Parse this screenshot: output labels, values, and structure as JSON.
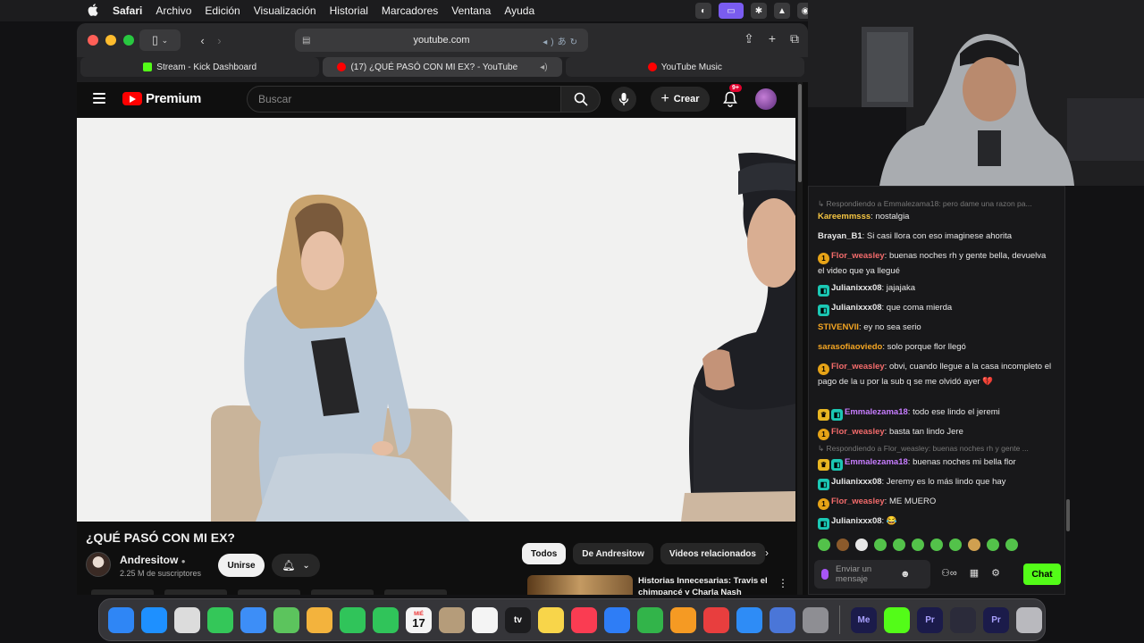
{
  "menubar": {
    "items": [
      "Safari",
      "Archivo",
      "Edición",
      "Visualización",
      "Historial",
      "Marcadores",
      "Ventana",
      "Ayuda"
    ]
  },
  "safari": {
    "address": "youtube.com",
    "tabs": [
      {
        "label": "Stream - Kick Dashboard",
        "favicon_color": "#53fc18"
      },
      {
        "label": "(17) ¿QUÉ PASÓ CON MI EX? - YouTube",
        "favicon_color": "#ff0000"
      },
      {
        "label": "YouTube Music",
        "favicon_color": "#ff0000"
      }
    ]
  },
  "youtube": {
    "logo_text": "Premium",
    "search_placeholder": "Buscar",
    "create_label": "Crear",
    "notif_badge": "9+",
    "video_title": "¿QUÉ PASÓ CON MI EX?",
    "channel_name": "Andresitow",
    "channel_subs": "2.25 M de suscriptores",
    "join_label": "Unirse",
    "chips": [
      "Todos",
      "De Andresitow",
      "Videos relacionados"
    ],
    "related_title": "Historias Innecesarias: Travis el chimpancé y Charla Nash"
  },
  "chat": {
    "messages": [
      {
        "type": "reply",
        "text": "Respondiendo a Emmalezama18: pero dame una razon pa..."
      },
      {
        "user": "Kareemmsss",
        "color": "#f5c542",
        "badges": [],
        "text": "nostalgia"
      },
      {
        "user": "Brayan_B1",
        "color": "#e8e8e8",
        "badges": [],
        "text": "Si casi llora con eso imaginese ahorita"
      },
      {
        "user": "Flor_weasley",
        "color": "#f36b6b",
        "badges": [
          "gold"
        ],
        "text": "buenas noches rh y gente bella, devuelva el video que ya llegué"
      },
      {
        "user": "Julianixxx08",
        "color": "#e8e8e8",
        "badges": [
          "teal"
        ],
        "text": "jajajaka"
      },
      {
        "user": "Julianixxx08",
        "color": "#e8e8e8",
        "badges": [
          "teal"
        ],
        "text": "que coma mierda"
      },
      {
        "user": "STIVENVII",
        "color": "#f5a623",
        "badges": [],
        "text": "ey no sea serio"
      },
      {
        "user": "sarasofiaoviedo",
        "color": "#f5a623",
        "badges": [],
        "text": "solo porque flor llegó"
      },
      {
        "user": "Flor_weasley",
        "color": "#f36b6b",
        "badges": [
          "gold"
        ],
        "text": "obvi, cuando llegue a la casa incompleto el pago de la u por la sub q se me olvidó ayer 💔"
      },
      {
        "user": "Emmalezama18",
        "color": "#c77dff",
        "badges": [
          "crown",
          "teal"
        ],
        "text": "todo ese lindo el jeremi"
      },
      {
        "user": "Flor_weasley",
        "color": "#f36b6b",
        "badges": [
          "gold"
        ],
        "text": "basta tan lindo Jere"
      },
      {
        "type": "reply",
        "text": "Respondiendo a Flor_weasley: buenas noches rh y gente ..."
      },
      {
        "user": "Emmalezama18",
        "color": "#c77dff",
        "badges": [
          "crown",
          "teal"
        ],
        "text": "buenas noches mi bella flor"
      },
      {
        "user": "Julianixxx08",
        "color": "#e8e8e8",
        "badges": [
          "teal"
        ],
        "text": "Jeremy es lo más lindo que hay"
      },
      {
        "user": "Flor_weasley",
        "color": "#f36b6b",
        "badges": [
          "gold"
        ],
        "text": "ME MUERO"
      },
      {
        "user": "Julianixxx08",
        "color": "#e8e8e8",
        "badges": [
          "teal"
        ],
        "text": "😂"
      }
    ],
    "input_placeholder": "Enviar un mensaje",
    "send_label": "Chat"
  },
  "dock": {
    "calendar_month": "MIÉ",
    "calendar_day": "17",
    "apps": [
      {
        "name": "finder",
        "color": "#2f86f5",
        "label": ""
      },
      {
        "name": "safari",
        "color": "#1e90ff",
        "label": ""
      },
      {
        "name": "launchpad",
        "color": "#dcdcdc",
        "label": ""
      },
      {
        "name": "messages",
        "color": "#34c759",
        "label": ""
      },
      {
        "name": "mail",
        "color": "#3d8ef7",
        "label": ""
      },
      {
        "name": "maps",
        "color": "#5cc45d",
        "label": ""
      },
      {
        "name": "photos",
        "color": "#f3b33d",
        "label": ""
      },
      {
        "name": "facetime",
        "color": "#30c45a",
        "label": ""
      },
      {
        "name": "phone",
        "color": "#30c45a",
        "label": ""
      },
      {
        "name": "calendar",
        "color": "#f4f4f4",
        "label": ""
      },
      {
        "name": "contacts",
        "color": "#b59c7a",
        "label": ""
      },
      {
        "name": "reminders",
        "color": "#f4f4f4",
        "label": ""
      },
      {
        "name": "tv",
        "color": "#1c1c1e",
        "label": "tv"
      },
      {
        "name": "notes",
        "color": "#f8d54a",
        "label": ""
      },
      {
        "name": "music",
        "color": "#fa3c52",
        "label": ""
      },
      {
        "name": "keynote",
        "color": "#2e7df6",
        "label": ""
      },
      {
        "name": "numbers",
        "color": "#32b44a",
        "label": ""
      },
      {
        "name": "pages",
        "color": "#f59a23",
        "label": ""
      },
      {
        "name": "rocket",
        "color": "#e83e3e",
        "label": ""
      },
      {
        "name": "app-store",
        "color": "#2e8cf6",
        "label": ""
      },
      {
        "name": "iphone-mirroring",
        "color": "#4a76d8",
        "label": ""
      },
      {
        "name": "system-settings",
        "color": "#8e8e93",
        "label": ""
      },
      {
        "name": "media-encoder",
        "color": "#1b1b4a",
        "label": "Me"
      },
      {
        "name": "kick",
        "color": "#53fc18",
        "label": ""
      },
      {
        "name": "premiere",
        "color": "#1b1b4a",
        "label": "Pr"
      },
      {
        "name": "obs",
        "color": "#2b2b3a",
        "label": ""
      },
      {
        "name": "premiere-pro-beta",
        "color": "#1b1b4a",
        "label": "Pr"
      },
      {
        "name": "trash",
        "color": "#b9b9be",
        "label": ""
      }
    ]
  }
}
